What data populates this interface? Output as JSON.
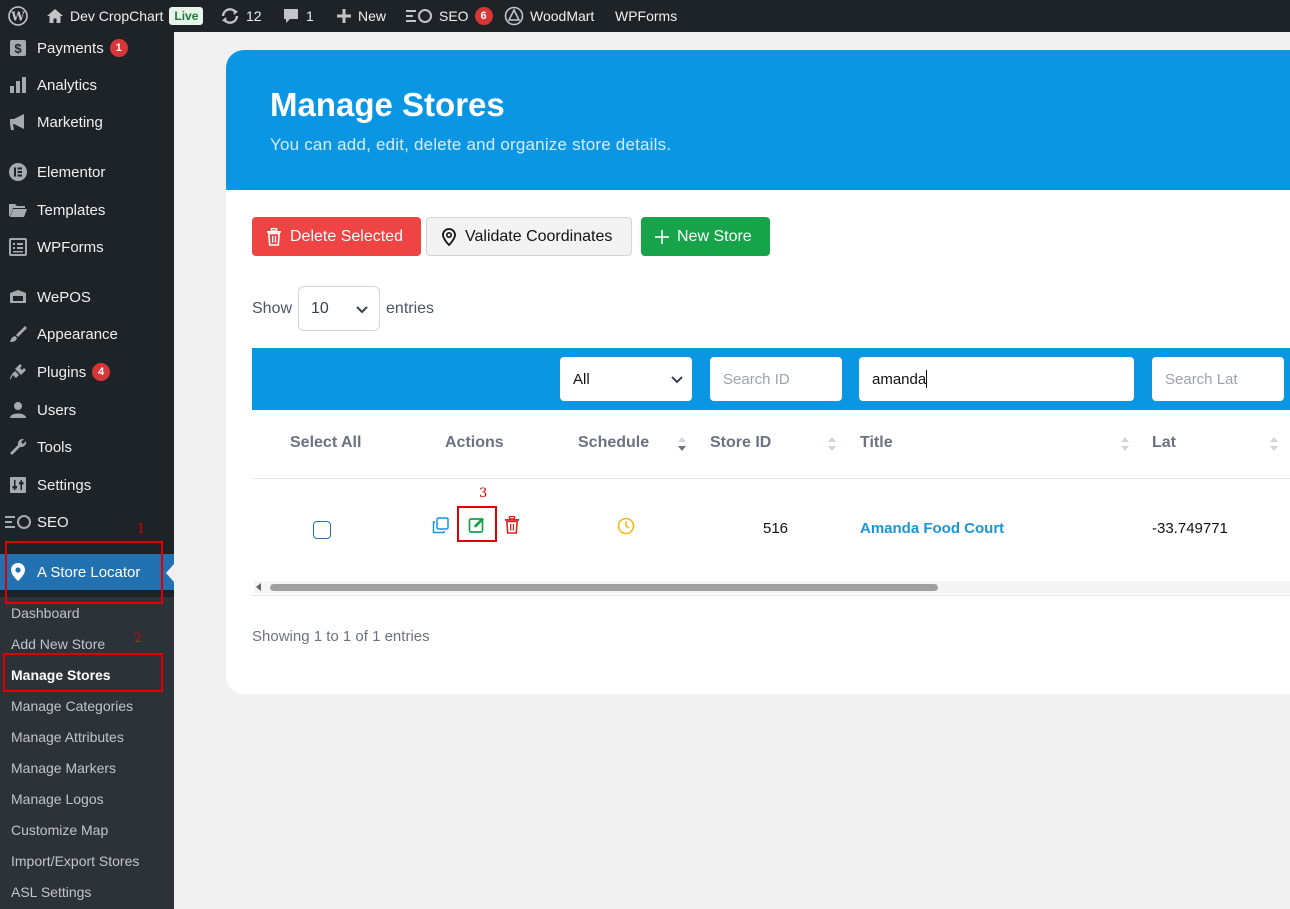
{
  "admin_bar": {
    "site_name": "Dev CropChart",
    "live_label": "Live",
    "updates_count": "12",
    "comments_count": "1",
    "new_label": "New",
    "seo_label": "SEO",
    "seo_count": "6",
    "woodmart_label": "WoodMart",
    "wpforms_label": "WPForms"
  },
  "sidebar": {
    "items": [
      {
        "label": "Payments",
        "icon": "dollar-icon",
        "badge": "1"
      },
      {
        "label": "Analytics",
        "icon": "bar-chart-icon"
      },
      {
        "label": "Marketing",
        "icon": "megaphone-icon"
      },
      {
        "label": "Elementor",
        "icon": "elementor-icon"
      },
      {
        "label": "Templates",
        "icon": "folder-icon"
      },
      {
        "label": "WPForms",
        "icon": "form-icon"
      },
      {
        "label": "WePOS",
        "icon": "pos-icon"
      },
      {
        "label": "Appearance",
        "icon": "brush-icon"
      },
      {
        "label": "Plugins",
        "icon": "plug-icon",
        "badge": "4"
      },
      {
        "label": "Users",
        "icon": "user-icon"
      },
      {
        "label": "Tools",
        "icon": "wrench-icon"
      },
      {
        "label": "Settings",
        "icon": "sliders-icon"
      },
      {
        "label": "SEO",
        "icon": "seo-icon"
      },
      {
        "label": "A Store Locator",
        "icon": "map-pin-icon"
      }
    ],
    "submenu": [
      "Dashboard",
      "Add New Store",
      "Manage Stores",
      "Manage Categories",
      "Manage Attributes",
      "Manage Markers",
      "Manage Logos",
      "Customize Map",
      "Import/Export Stores",
      "ASL Settings"
    ]
  },
  "annotations": [
    "1",
    "2",
    "3"
  ],
  "page": {
    "title": "Manage Stores",
    "subtitle": "You can add, edit, delete and organize store details.",
    "buttons": {
      "delete_selected": "Delete Selected",
      "validate_coordinates": "Validate Coordinates",
      "new_store": "New Store"
    },
    "show_label": "Show",
    "entries_label": "entries",
    "entries_value": "10",
    "filters": {
      "category_value": "All",
      "search_id_placeholder": "Search ID",
      "title_value": "amanda",
      "search_lat_placeholder": "Search Lat"
    },
    "columns": [
      "Select All",
      "Actions",
      "Schedule",
      "Store ID",
      "Title",
      "Lat"
    ],
    "rows": [
      {
        "store_id": "516",
        "title": "Amanda Food Court",
        "lat": "-33.749771"
      }
    ],
    "footer": "Showing 1 to 1 of 1 entries"
  },
  "colors": {
    "accent_blue": "#0a96e3",
    "delete_red": "#ef4444",
    "new_green": "#16a34a",
    "annotation_red": "#e00000"
  }
}
